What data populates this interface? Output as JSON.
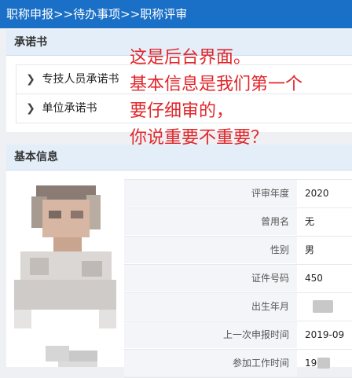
{
  "breadcrumb": "职称申报>>待办事项>>职称评审",
  "pledge_section": {
    "title": "承诺书",
    "items": [
      {
        "label": "专技人员承诺书"
      },
      {
        "label": "单位承诺书"
      }
    ]
  },
  "basic_info": {
    "title": "基本信息",
    "rows": [
      {
        "label": "评审年度",
        "value": "2020"
      },
      {
        "label": "曾用名",
        "value": "无"
      },
      {
        "label": "性别",
        "value": "男"
      },
      {
        "label": "证件号码",
        "value": "450"
      },
      {
        "label": "出生年月",
        "value": ""
      },
      {
        "label": "上一次申报时间",
        "value": "2019-09"
      },
      {
        "label": "参加工作时间",
        "value": "19"
      }
    ]
  },
  "annotation": {
    "lines": [
      "这是后台界面。",
      "基本信息是我们第一个",
      "要仔细审的，",
      "你说重要不重要？"
    ]
  },
  "icons": {
    "row_chevron": "chevron-right-icon"
  },
  "colors": {
    "topbar": "#1a6fc6",
    "panel_header": "#e3eef9",
    "annotation": "#e0262b"
  }
}
